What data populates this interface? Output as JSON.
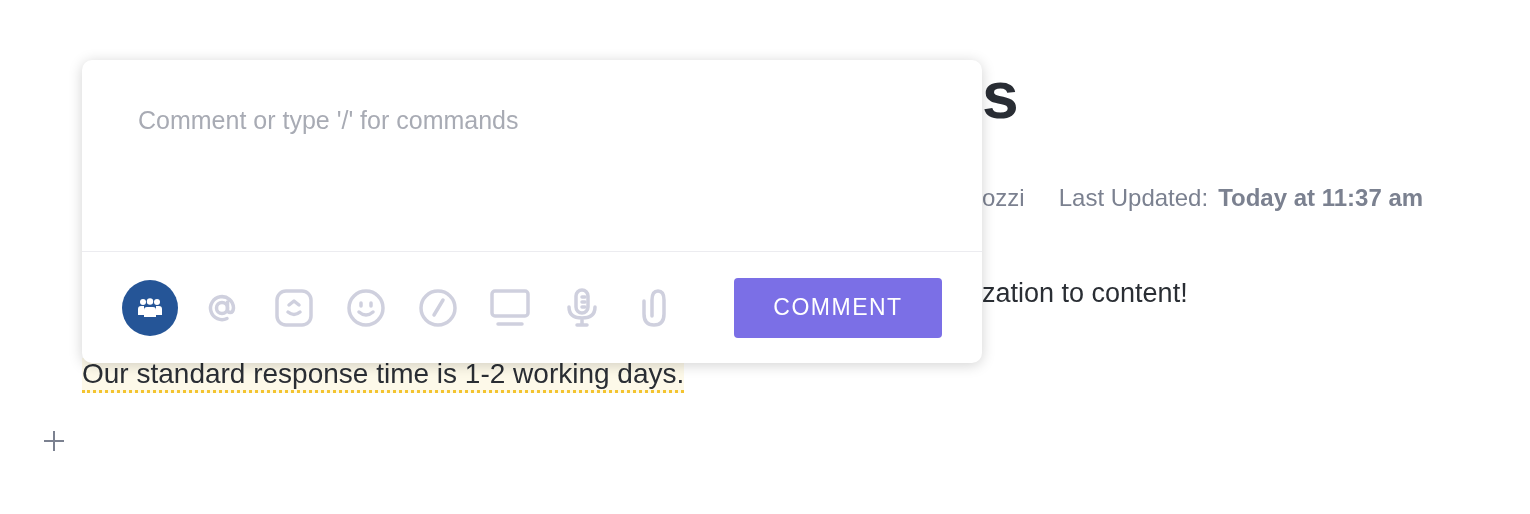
{
  "page": {
    "title_fragment": "s",
    "author_fragment": "ozzi",
    "last_updated_label": "Last Updated:",
    "last_updated_value": "Today at 11:37 am",
    "body_fragment": "zation to content!",
    "commented_text": {
      "text": "Our standard response time is 1-2 working days.",
      "highlighted": true
    }
  },
  "comment_box": {
    "placeholder": "Comment or type '/' for commands",
    "tools": [
      {
        "kind": "people",
        "selected": true
      },
      {
        "kind": "mention",
        "selected": false
      },
      {
        "kind": "clickup",
        "selected": false
      },
      {
        "kind": "emoji",
        "selected": false
      },
      {
        "kind": "slash",
        "selected": false
      },
      {
        "kind": "screen",
        "selected": false
      },
      {
        "kind": "mic",
        "selected": false
      },
      {
        "kind": "attach",
        "selected": false
      }
    ],
    "button": "COMMENT"
  }
}
